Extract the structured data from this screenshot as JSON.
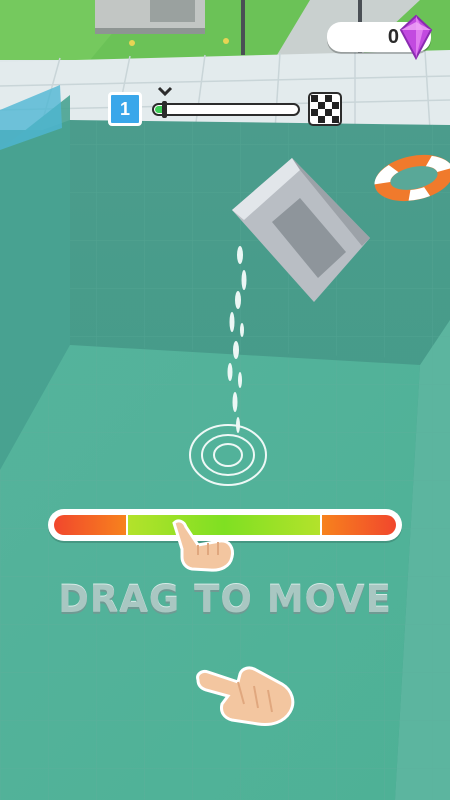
{
  "hud": {
    "gems": "0",
    "gem_icon": "pink-diamond-icon",
    "level": "1",
    "level_progress": 0.08,
    "finish_icon": "checkered-flag-icon"
  },
  "meter": {
    "zones": [
      "red",
      "green",
      "red"
    ],
    "colors": {
      "red": "#f1472d",
      "orange": "#f7821d",
      "green": "#7fe022"
    }
  },
  "tutorial": {
    "hint": "DRAG TO MOVE",
    "hand_icon": "pointing-hand-icon"
  },
  "scene": {
    "water_color": "#4c9a88",
    "pool_tile_color": "#dfe8ea",
    "ring_buoy_colors": [
      "#f07a2c",
      "#ffffff"
    ]
  }
}
